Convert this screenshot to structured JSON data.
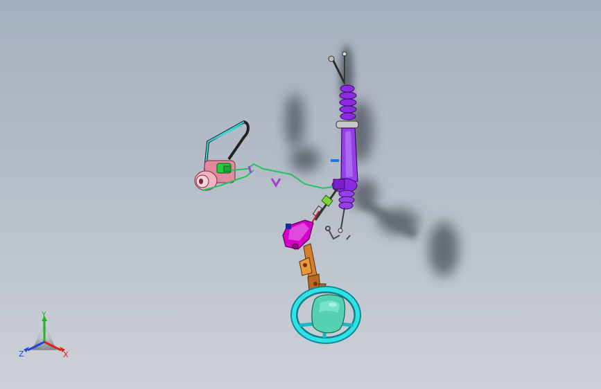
{
  "view": {
    "background_top": "#a4afbd",
    "background_bottom": "#cdd1d7"
  },
  "assembly": {
    "parts": [
      "steering-rack-icon",
      "tie-rod-icon",
      "power-steering-pump-icon",
      "pressure-hose-icon",
      "intermediate-shaft-icon",
      "column-bracket-icon",
      "steering-column-icon",
      "steering-wheel-icon",
      "airbag-icon"
    ],
    "colors": {
      "rack": "#8a2be2",
      "hose": "#22c55e",
      "pump": "#e79aa8",
      "bracket": "#d400c8",
      "column": "#d08030",
      "wheel": "#25d8dc",
      "airbag": "#55d0b0"
    }
  },
  "triad": {
    "x_label": "X",
    "y_label": "Y",
    "z_label": "Z",
    "x_color": "#e01e1e",
    "y_color": "#1db81d",
    "z_color": "#2244dd"
  }
}
